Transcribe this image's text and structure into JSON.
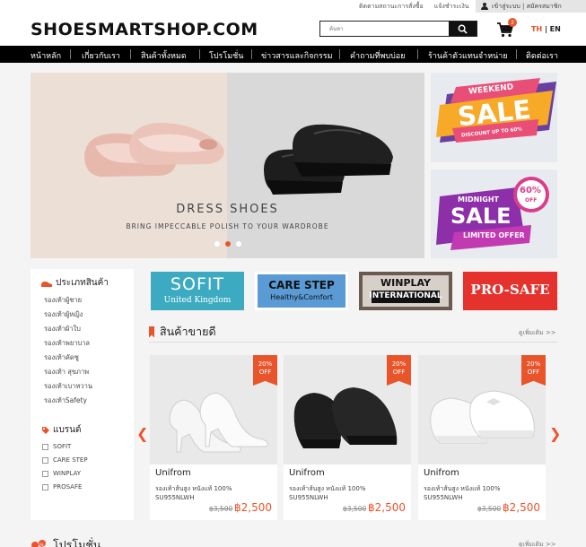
{
  "top_links": {
    "order_status": "ติดตามสถานะการสั่งซื้อ",
    "payment": "แจ้งชำระเงิน",
    "login_register": "เข้าสู่ระบบ | สมัครสมาชิก"
  },
  "header": {
    "logo": "SHOESMARTSHOP.COM",
    "search_placeholder": "ค้นหา",
    "cart_count": "2",
    "lang_th": "TH",
    "lang_sep": " | ",
    "lang_en": "EN"
  },
  "nav": [
    "หน้าหลัก",
    "เกี่ยวกับเรา",
    "สินค้าทั้งหมด",
    "โปรโมชั่น",
    "ข่าวสารและกิจกรรม",
    "คำถามที่พบบ่อย",
    "ร้านค้าตัวแทนจำหน่าย",
    "ติดต่อเรา"
  ],
  "banner": {
    "title": "DRESS SHOES",
    "subtitle": "BRING IMPECCABLE POLISH TO YOUR WARDROBE",
    "slides": 3,
    "active_slide": 2
  },
  "promo1": {
    "top": "WEEKEND",
    "main": "SALE",
    "sub": "DISCOUNT UP TO 60%"
  },
  "promo2": {
    "top": "MIDNIGHT",
    "main": "SALE",
    "pct": "60%",
    "off": "OFF",
    "sub": "LIMITED OFFER"
  },
  "sidebar": {
    "category_title": "ประเภทสินค้า",
    "categories": [
      "รองเท้าผู้ชาย",
      "รองเท้าผู้หญิง",
      "รองเท้าผ้าใบ",
      "รองเท้าพยาบาล",
      "รองเท้าคัดชู",
      "รองเท้า สุขภาพ",
      "รองเท้าเบาหวาน",
      "รองเท้าSafety"
    ],
    "brand_title": "แบรนด์",
    "brands": [
      "SOFIT",
      "CARE STEP",
      "WINPLAY",
      "PROSAFE"
    ]
  },
  "brand_logos": {
    "sofit": {
      "name": "SOFIT",
      "sub": "United Kingdom",
      "color": "#3cabc2"
    },
    "carestep": {
      "name": "CARE STEP",
      "sub": "Healthy&Comfort",
      "color": "#5b9bd5"
    },
    "winplay": {
      "name": "WINPLAY",
      "sub": "INTERNATIONAL",
      "color": "#6b5a50"
    },
    "prosafe": {
      "name": "PRO-SAFE",
      "color": "#e5322d"
    }
  },
  "bestseller": {
    "title": "สินค้าขายดี",
    "more": "ดูเพิ่มเติม >>",
    "products": [
      {
        "discount": "20%",
        "discount_off": "OFF",
        "brand": "Unifrom",
        "desc1": "รองเท้าส้นสูง หนังแท้ 100%",
        "desc2": "SU955NLWH",
        "old_price": "฿3,500",
        "price": "฿2,500"
      },
      {
        "discount": "20%",
        "discount_off": "OFF",
        "brand": "Unifrom",
        "desc1": "รองเท้าส้นสูง หนังแท้ 100%",
        "desc2": "SU955NLWH",
        "old_price": "฿3,500",
        "price": "฿2,500"
      },
      {
        "discount": "20%",
        "discount_off": "OFF",
        "brand": "Unifrom",
        "desc1": "รองเท้าส้นสูง หนังแท้ 100%",
        "desc2": "SU955NLWH",
        "old_price": "฿3,500",
        "price": "฿2,500"
      }
    ]
  },
  "promotion": {
    "title": "โปรโมชั่น",
    "more": "ดูเพิ่มเติม >>"
  },
  "colors": {
    "accent": "#e9542b",
    "nav_bg": "#000000"
  }
}
